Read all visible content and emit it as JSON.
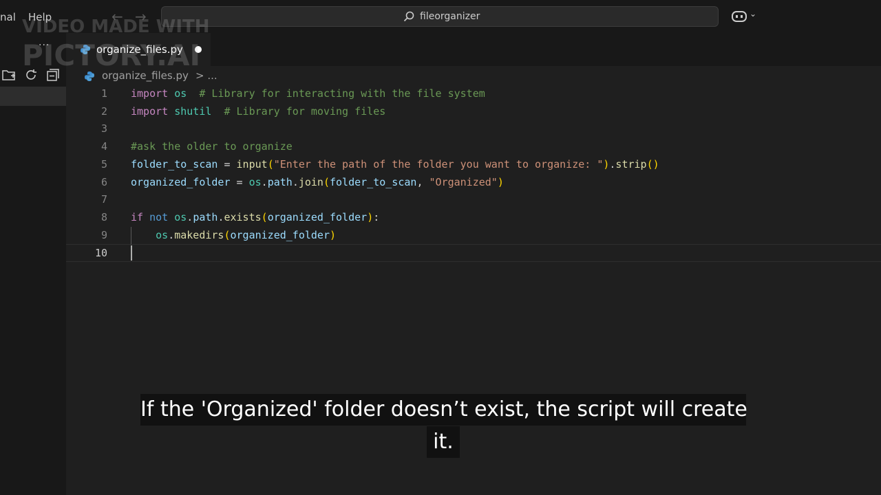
{
  "menu": {
    "items": [
      "nal",
      "Help"
    ]
  },
  "search": {
    "text": "fileorganizer"
  },
  "tab": {
    "label": "organize_files.py"
  },
  "breadcrumb": {
    "file": "organize_files.py",
    "rest": "> ..."
  },
  "watermark": {
    "line1": "VIDEO MADE WITH",
    "line2": "PICTORY.AI"
  },
  "editor": {
    "line_numbers": [
      "1",
      "2",
      "3",
      "4",
      "5",
      "6",
      "7",
      "8",
      "9",
      "10"
    ],
    "active_line": 10,
    "lines": [
      [
        {
          "t": "import",
          "c": "kw"
        },
        {
          "t": " ",
          "c": "pl"
        },
        {
          "t": "os",
          "c": "mod"
        },
        {
          "t": "  # Library for interacting with the file system",
          "c": "cm"
        }
      ],
      [
        {
          "t": "import",
          "c": "kw"
        },
        {
          "t": " ",
          "c": "pl"
        },
        {
          "t": "shutil",
          "c": "mod"
        },
        {
          "t": "  # Library for moving files",
          "c": "cm"
        }
      ],
      [],
      [
        {
          "t": "#ask the older to organize",
          "c": "cm"
        }
      ],
      [
        {
          "t": "folder_to_scan",
          "c": "var"
        },
        {
          "t": " = ",
          "c": "pl"
        },
        {
          "t": "input",
          "c": "fn"
        },
        {
          "t": "(",
          "c": "p1"
        },
        {
          "t": "\"Enter the path of the folder you want to organize: \"",
          "c": "str"
        },
        {
          "t": ")",
          "c": "p1"
        },
        {
          "t": ".",
          "c": "pl"
        },
        {
          "t": "strip",
          "c": "fn"
        },
        {
          "t": "()",
          "c": "p1"
        }
      ],
      [
        {
          "t": "organized_folder",
          "c": "var"
        },
        {
          "t": " = ",
          "c": "pl"
        },
        {
          "t": "os",
          "c": "mod"
        },
        {
          "t": ".",
          "c": "pl"
        },
        {
          "t": "path",
          "c": "var"
        },
        {
          "t": ".",
          "c": "pl"
        },
        {
          "t": "join",
          "c": "fn"
        },
        {
          "t": "(",
          "c": "p1"
        },
        {
          "t": "folder_to_scan",
          "c": "var"
        },
        {
          "t": ", ",
          "c": "pl"
        },
        {
          "t": "\"Organized\"",
          "c": "str"
        },
        {
          "t": ")",
          "c": "p1"
        }
      ],
      [],
      [
        {
          "t": "if",
          "c": "kw"
        },
        {
          "t": " ",
          "c": "pl"
        },
        {
          "t": "not",
          "c": "kw2"
        },
        {
          "t": " ",
          "c": "pl"
        },
        {
          "t": "os",
          "c": "mod"
        },
        {
          "t": ".",
          "c": "pl"
        },
        {
          "t": "path",
          "c": "var"
        },
        {
          "t": ".",
          "c": "pl"
        },
        {
          "t": "exists",
          "c": "fn"
        },
        {
          "t": "(",
          "c": "p1"
        },
        {
          "t": "organized_folder",
          "c": "var"
        },
        {
          "t": ")",
          "c": "p1"
        },
        {
          "t": ":",
          "c": "pl"
        }
      ],
      [
        {
          "t": "    ",
          "c": "pl"
        },
        {
          "t": "os",
          "c": "mod"
        },
        {
          "t": ".",
          "c": "pl"
        },
        {
          "t": "makedirs",
          "c": "fn"
        },
        {
          "t": "(",
          "c": "p1"
        },
        {
          "t": "organized_folder",
          "c": "var"
        },
        {
          "t": ")",
          "c": "p1"
        }
      ],
      []
    ]
  },
  "caption": {
    "line1": "If the 'Organized' folder doesn’t exist, the script will create",
    "line2": "it."
  },
  "colors": {
    "background": "#1f1f1f",
    "chrome": "#181818",
    "accent": "#0078d4"
  }
}
